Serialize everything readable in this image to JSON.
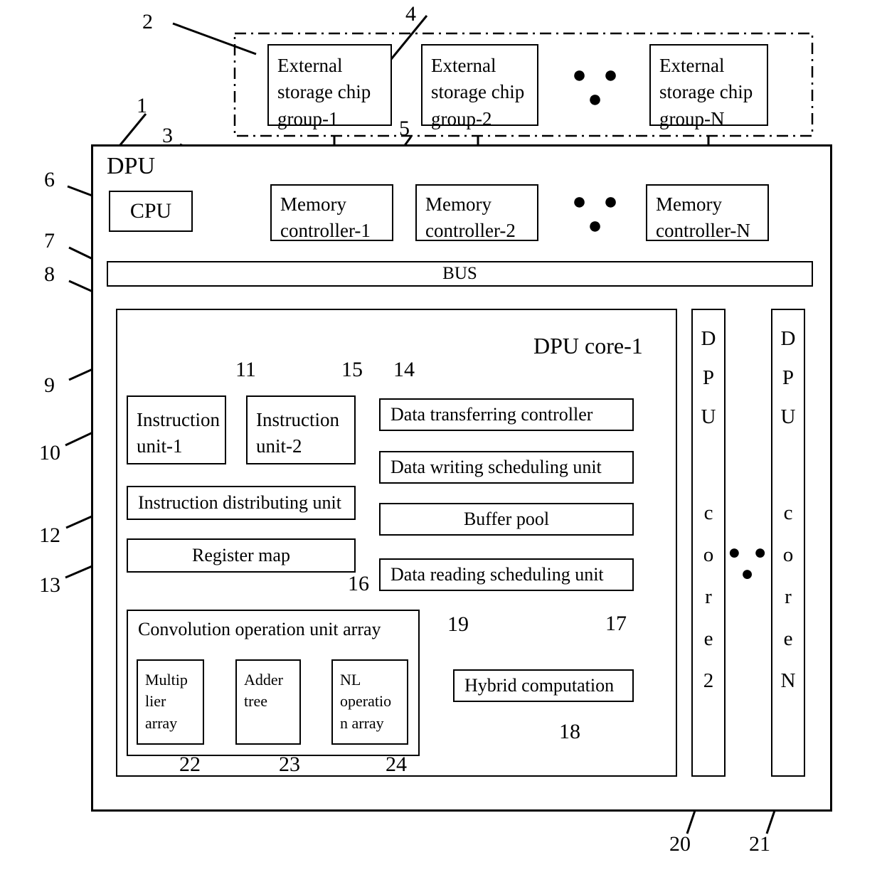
{
  "figure": {
    "title": "DPU architecture block diagram",
    "dpu_label": "DPU",
    "bus_label": "BUS",
    "cpu_label": "CPU",
    "core1_label": "DPU core-1",
    "ellipsis": "● ● ●"
  },
  "external_storage": {
    "groups": [
      {
        "l1": "External",
        "l2": "storage   chip",
        "l3": "group-1"
      },
      {
        "l1": "External",
        "l2": "storage   chip",
        "l3": "group-2"
      },
      {
        "l1": "External",
        "l2": "storage   chip",
        "l3": "group-N"
      }
    ]
  },
  "memory_controllers": {
    "items": [
      {
        "l1": "Memory",
        "l2": "controller-1"
      },
      {
        "l1": "Memory",
        "l2": "controller-2"
      },
      {
        "l1": "Memory",
        "l2": "controller-N"
      }
    ]
  },
  "core1": {
    "instruction_unit_1": {
      "l1": "Instruction",
      "l2": "unit-1"
    },
    "instruction_unit_2": {
      "l1": "Instruction",
      "l2": "unit-2"
    },
    "instruction_distributing_unit": "Instruction distributing unit",
    "register_map": "Register map",
    "data_transferring_controller": "Data transferring controller",
    "data_writing_scheduling_unit": "Data writing scheduling unit",
    "buffer_pool": "Buffer pool",
    "data_reading_scheduling_unit": "Data reading scheduling unit",
    "hybrid_computation": "Hybrid computation",
    "conv_array_title": "Convolution operation unit array",
    "multiplier_array": {
      "l1": "Multip",
      "l2": "lier",
      "l3": "array"
    },
    "adder_tree": {
      "l1": "Adder",
      "l2": "tree"
    },
    "nl_operation_array": {
      "l1": "NL",
      "l2": "operatio",
      "l3": "n array"
    }
  },
  "other_cores": {
    "core2": {
      "letters": [
        "D",
        "P",
        "U"
      ],
      "letters2": [
        "c",
        "o",
        "r",
        "e",
        "2"
      ]
    },
    "coreN": {
      "letters": [
        "D",
        "P",
        "U"
      ],
      "letters2": [
        "c",
        "o",
        "r",
        "e",
        "N"
      ]
    }
  },
  "reference_numbers": {
    "n1": "1",
    "n2": "2",
    "n3": "3",
    "n4": "4",
    "n5": "5",
    "n6": "6",
    "n7": "7",
    "n8": "8",
    "n9": "9",
    "n10": "10",
    "n11": "11",
    "n12": "12",
    "n13": "13",
    "n14": "14",
    "n15": "15",
    "n16": "16",
    "n17": "17",
    "n18": "18",
    "n19": "19",
    "n20": "20",
    "n21": "21",
    "n22": "22",
    "n23": "23",
    "n24": "24"
  },
  "colors": {
    "stroke": "#000000",
    "background": "#ffffff"
  }
}
